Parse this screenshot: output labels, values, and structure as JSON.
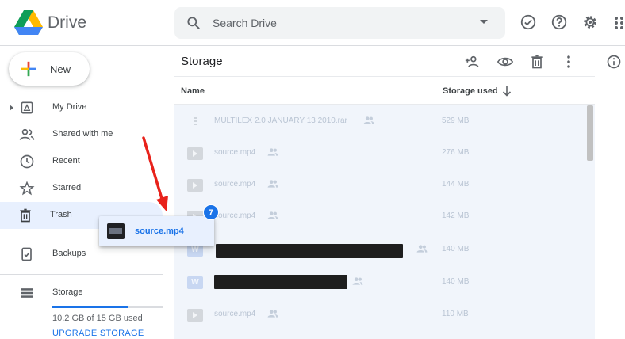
{
  "header": {
    "brand": "Drive",
    "search_placeholder": "Search Drive",
    "icons": [
      "check-circle-icon",
      "help-icon",
      "settings-icon",
      "apps-icon"
    ]
  },
  "sidebar": {
    "new_label": "New",
    "items": [
      {
        "label": "My Drive",
        "icon": "my-drive-icon"
      },
      {
        "label": "Shared with me",
        "icon": "shared-icon"
      },
      {
        "label": "Recent",
        "icon": "clock-icon"
      },
      {
        "label": "Starred",
        "icon": "star-icon"
      },
      {
        "label": "Trash",
        "icon": "trash-icon"
      },
      {
        "label": "Backups",
        "icon": "backups-icon"
      },
      {
        "label": "Storage",
        "icon": "storage-icon"
      }
    ],
    "storage_used_text": "10.2 GB of 15 GB used",
    "storage_fraction": 0.68,
    "upgrade_label": "UPGRADE STORAGE"
  },
  "main": {
    "title": "Storage",
    "toolbar_icons": [
      "add-person-icon",
      "preview-icon",
      "delete-icon",
      "more-icon",
      "info-icon"
    ],
    "columns": {
      "name": "Name",
      "storage": "Storage used"
    },
    "rows": [
      {
        "name": "MULTILEX 2.0 JANUARY 13 2010.rar",
        "size": "529 MB",
        "type": "archive",
        "shared": true
      },
      {
        "name": "source.mp4",
        "size": "276 MB",
        "type": "video",
        "shared": true
      },
      {
        "name": "source.mp4",
        "size": "144 MB",
        "type": "video",
        "shared": true
      },
      {
        "name": "source.mp4",
        "size": "142 MB",
        "type": "video",
        "shared": true
      },
      {
        "name": "",
        "size": "140 MB",
        "type": "doc",
        "shared": true,
        "redacted": true
      },
      {
        "name": "",
        "size": "140 MB",
        "type": "doc",
        "shared": true,
        "redacted": true
      },
      {
        "name": "source.mp4",
        "size": "110 MB",
        "type": "video",
        "shared": true
      }
    ]
  },
  "drag": {
    "file_name": "source.mp4",
    "count": "7"
  },
  "colors": {
    "accent": "#1a73e8",
    "active_nav": "#e8f0fe"
  }
}
